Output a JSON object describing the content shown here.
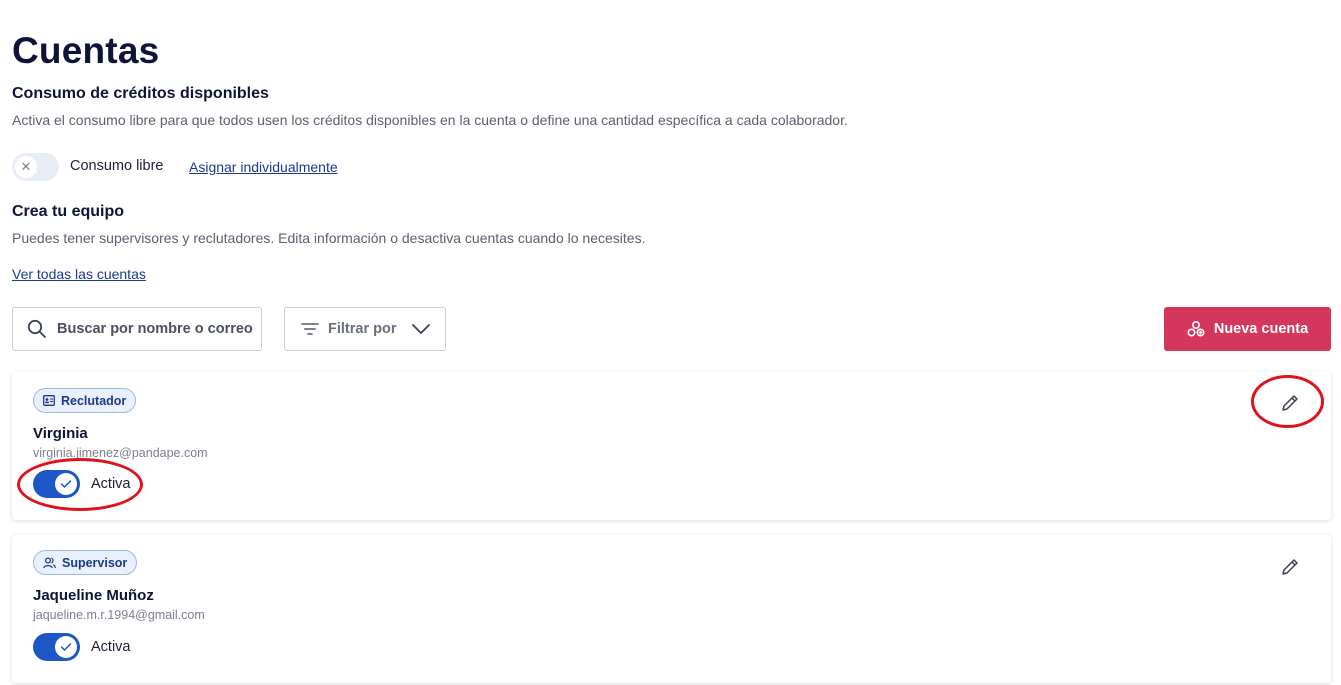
{
  "page": {
    "title": "Cuentas"
  },
  "credits": {
    "title": "Consumo de créditos disponibles",
    "description": "Activa el consumo libre para que todos usen los créditos disponibles en la cuenta o define una cantidad específica a cada colaborador.",
    "toggle_label": "Consumo libre",
    "toggle_on": false,
    "assign_link": "Asignar individualmente"
  },
  "team": {
    "title": "Crea tu equipo",
    "description": "Puedes tener supervisores y reclutadores. Edita información o desactiva cuentas cuando lo necesites.",
    "view_all_link": "Ver todas las cuentas"
  },
  "toolbar": {
    "search_placeholder": "Buscar por nombre o correo",
    "filter_label": "Filtrar por",
    "new_account_label": "Nueva cuenta"
  },
  "accounts": [
    {
      "role": "Reclutador",
      "role_icon": "id-card-icon",
      "name": "Virginia",
      "email": "virginia.jimenez@pandape.com",
      "status": "Activa",
      "active": true
    },
    {
      "role": "Supervisor",
      "role_icon": "users-icon",
      "name": "Jaqueline Muñoz",
      "email": "jaqueline.m.r.1994@gmail.com",
      "status": "Activa",
      "active": true
    }
  ],
  "colors": {
    "accent": "#d4365c",
    "toggle_active": "#1d57c7",
    "badge_text": "#1b3a8f",
    "annotation": "#e0121b"
  }
}
